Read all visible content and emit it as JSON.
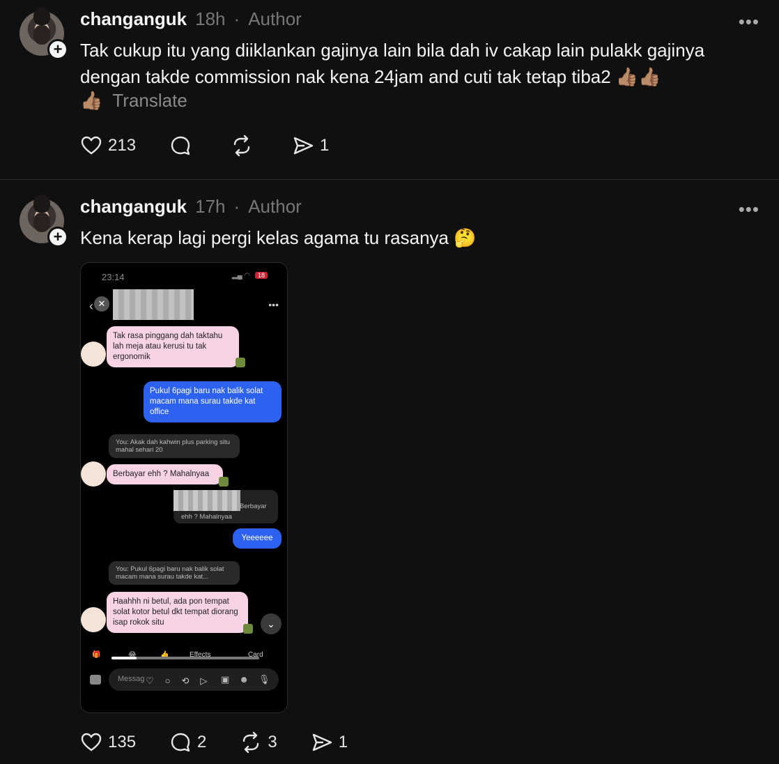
{
  "posts": [
    {
      "username": "changanguk",
      "time": "18h",
      "separator": "·",
      "role": "Author",
      "text": "Tak cukup itu yang diiklankan gajinya lain bila dah iv cakap lain pulakk gajinya dengan takde commission nak kena 24jam and cuti tak tetap tiba2 👍🏽👍🏽",
      "text_tail": "👍🏽",
      "translate_label": "Translate",
      "likes": "213",
      "replies": "",
      "reposts": "",
      "shares": "1"
    },
    {
      "username": "changanguk",
      "time": "17h",
      "separator": "·",
      "role": "Author",
      "text": "Kena kerap lagi pergi kelas agama tu rasanya 🤔",
      "likes": "135",
      "replies": "2",
      "reposts": "3",
      "shares": "1"
    }
  ],
  "more_icon": "•••",
  "follow_icon": "+",
  "phone": {
    "status_time": "23:14",
    "battery": "18",
    "messages": {
      "m1": "Tak rasa pinggang dah taktahu lah meja atau kerusi tu tak ergonomik",
      "m2": "Pukul 6pagi baru nak balik solat macam mana surau takde kat office",
      "ctx1": "You: Akak dah kahwin plus parking situ mahal sehari 20",
      "m3": "Berbayar ehh ? Mahalnyaa",
      "reply_quote_1": "Berbayar",
      "reply_quote_2": "ehh ? Mahalnyaa",
      "m4": "Yeeeeee",
      "ctx2": "You: Pukul 6pagi baru nak balik solat macam mana surau takde kat...",
      "m5": "Haahhh ni betul, ada pon tempat solat kotor betul dkt tempat diorang isap rokok situ"
    },
    "toolbar": {
      "effects": "Effects",
      "cards": "Card"
    },
    "message_placeholder": "Messag"
  }
}
